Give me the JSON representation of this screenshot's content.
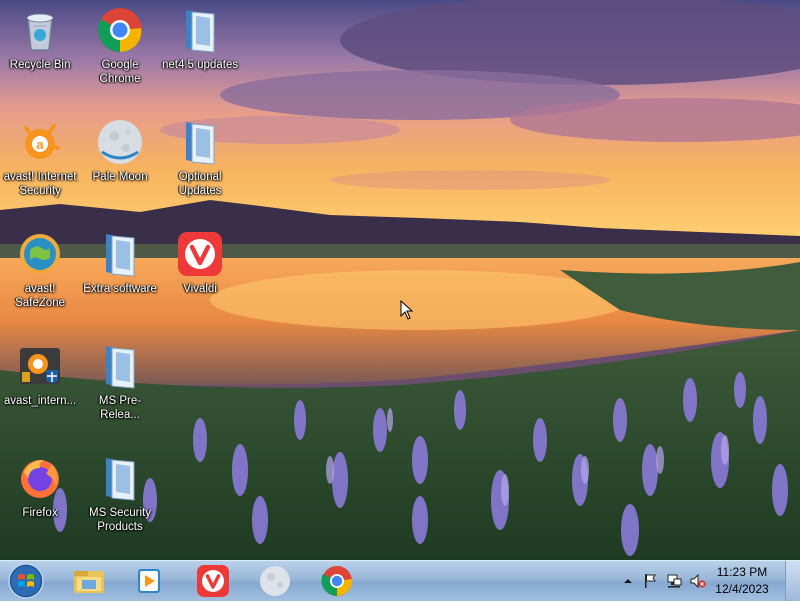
{
  "desktop": {
    "icons": [
      {
        "label": "Recycle Bin",
        "icon": "recycle-bin-icon"
      },
      {
        "label": "Google Chrome",
        "icon": "chrome-icon"
      },
      {
        "label": "net4.5 updates",
        "icon": "folder-icon"
      },
      {
        "label": "avast! Internet Security",
        "icon": "avast-icon"
      },
      {
        "label": "Pale Moon",
        "icon": "pale-moon-icon"
      },
      {
        "label": "Optional Updates",
        "icon": "folder-icon"
      },
      {
        "label": "avast! SafeZone",
        "icon": "safezone-icon"
      },
      {
        "label": "Extra software",
        "icon": "folder-icon"
      },
      {
        "label": "Vivaldi",
        "icon": "vivaldi-icon"
      },
      {
        "label": "avast_intern...",
        "icon": "avast-installer-icon"
      },
      {
        "label": "MS Pre-Relea...",
        "icon": "folder-icon"
      },
      {
        "label": "Firefox",
        "icon": "firefox-icon"
      },
      {
        "label": "MS Security Products",
        "icon": "folder-icon"
      }
    ]
  },
  "taskbar": {
    "start_button": "start-orb-icon",
    "pinned": [
      "windows-explorer-icon",
      "media-player-icon",
      "vivaldi-icon",
      "pale-moon-icon",
      "chrome-icon"
    ],
    "tray": {
      "icons": [
        "show-hidden-icons-icon",
        "action-center-flag-icon",
        "network-icon",
        "volume-muted-icon"
      ],
      "time": "11:23 PM",
      "date": "12/4/2023"
    }
  },
  "colors": {
    "vivaldi": "#ef3939",
    "avast_orange": "#f7941d",
    "taskbar": "#9ab7d9"
  }
}
